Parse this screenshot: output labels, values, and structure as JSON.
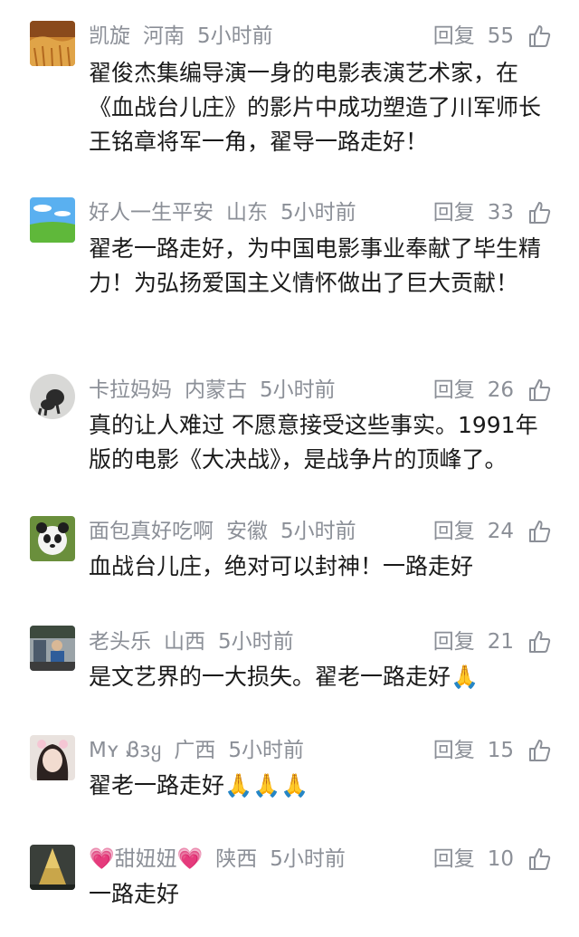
{
  "reply_label": "回复",
  "comments": [
    {
      "user": "凯旋",
      "location": "河南",
      "time": "5小时前",
      "likes": "55",
      "text": "翟俊杰集编导演一身的电影表演艺术家，在《血战台儿庄》的影片中成功塑造了川军师长王铭章将军一角，翟导一路走好！",
      "emoji": ""
    },
    {
      "user": "好人一生平安",
      "location": "山东",
      "time": "5小时前",
      "likes": "33",
      "text": "翟老一路走好，为中国电影事业奉献了毕生精力！为弘扬爱国主义情怀做出了巨大贡献！",
      "emoji": ""
    },
    {
      "user": "卡拉妈妈",
      "location": "内蒙古",
      "time": "5小时前",
      "likes": "26",
      "text": "真的让人难过 不愿意接受这些事实。1991年版的电影《大决战》，是战争片的顶峰了。",
      "emoji": ""
    },
    {
      "user": "面包真好吃啊",
      "location": "安徽",
      "time": "5小时前",
      "likes": "24",
      "text": "血战台儿庄，绝对可以封神！一路走好",
      "emoji": ""
    },
    {
      "user": "老头乐",
      "location": "山西",
      "time": "5小时前",
      "likes": "21",
      "text": "是文艺界的一大损失。翟老一路走好",
      "emoji": "🙏"
    },
    {
      "user": "Mʏ Ᏸɜყ",
      "location": "广西",
      "time": "5小时前",
      "likes": "15",
      "text": "翟老一路走好",
      "emoji": "🙏🙏🙏"
    },
    {
      "user": "💗甜妞妞💗",
      "location": "陕西",
      "time": "5小时前",
      "likes": "10",
      "text": "一路走好",
      "emoji": ""
    }
  ],
  "avatar_icons": [
    "wheat-field-avatar",
    "sky-grass-avatar",
    "dog-avatar",
    "panda-avatar",
    "street-photo-avatar",
    "girl-avatar",
    "christmas-tree-avatar"
  ]
}
